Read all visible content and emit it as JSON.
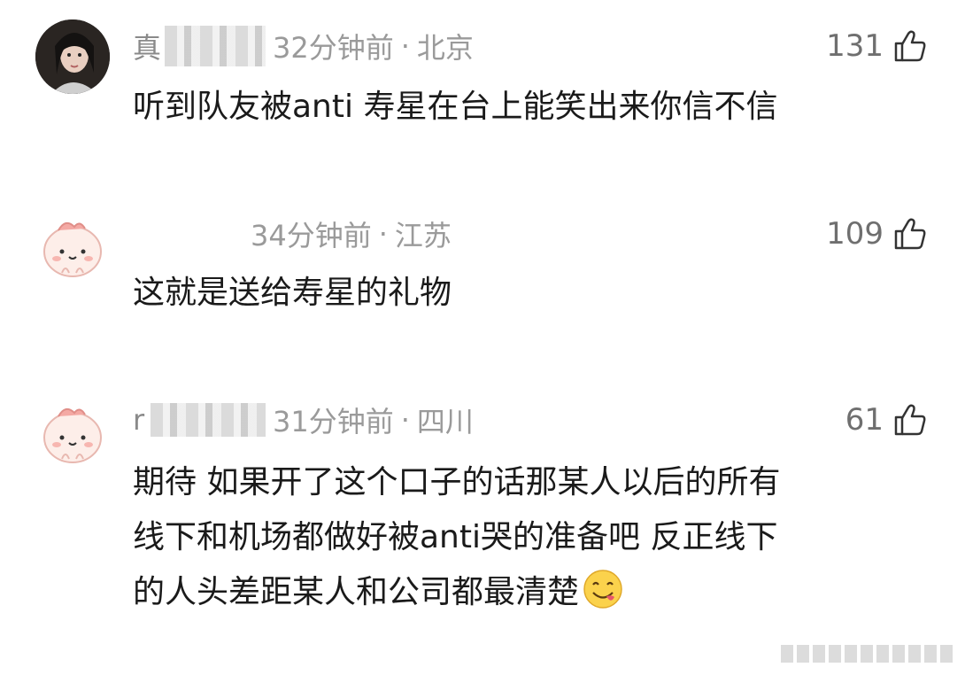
{
  "comments": [
    {
      "username": "真",
      "time": "32分钟前",
      "location": "北京",
      "likes": "131",
      "text": "听到队友被anti 寿星在台上能笑出来你信不信",
      "avatar": "photo-avatar"
    },
    {
      "username": "",
      "time": "34分钟前",
      "location": "江苏",
      "likes": "109",
      "text": "这就是送给寿星的礼物",
      "avatar": "cartoon-avatar"
    },
    {
      "username": "r",
      "time": "31分钟前",
      "location": "四川",
      "likes": "61",
      "text_lines": [
        "期待 如果开了这个口子的话那某人以后的所有",
        "线下和机场都做好被anti哭的准备吧 反正线下",
        "的人头差距某人和公司都最清楚"
      ],
      "emoji": "yum-emoji",
      "avatar": "cartoon-avatar"
    }
  ],
  "separator": "·",
  "icons": {
    "like": "thumbs-up-icon"
  }
}
